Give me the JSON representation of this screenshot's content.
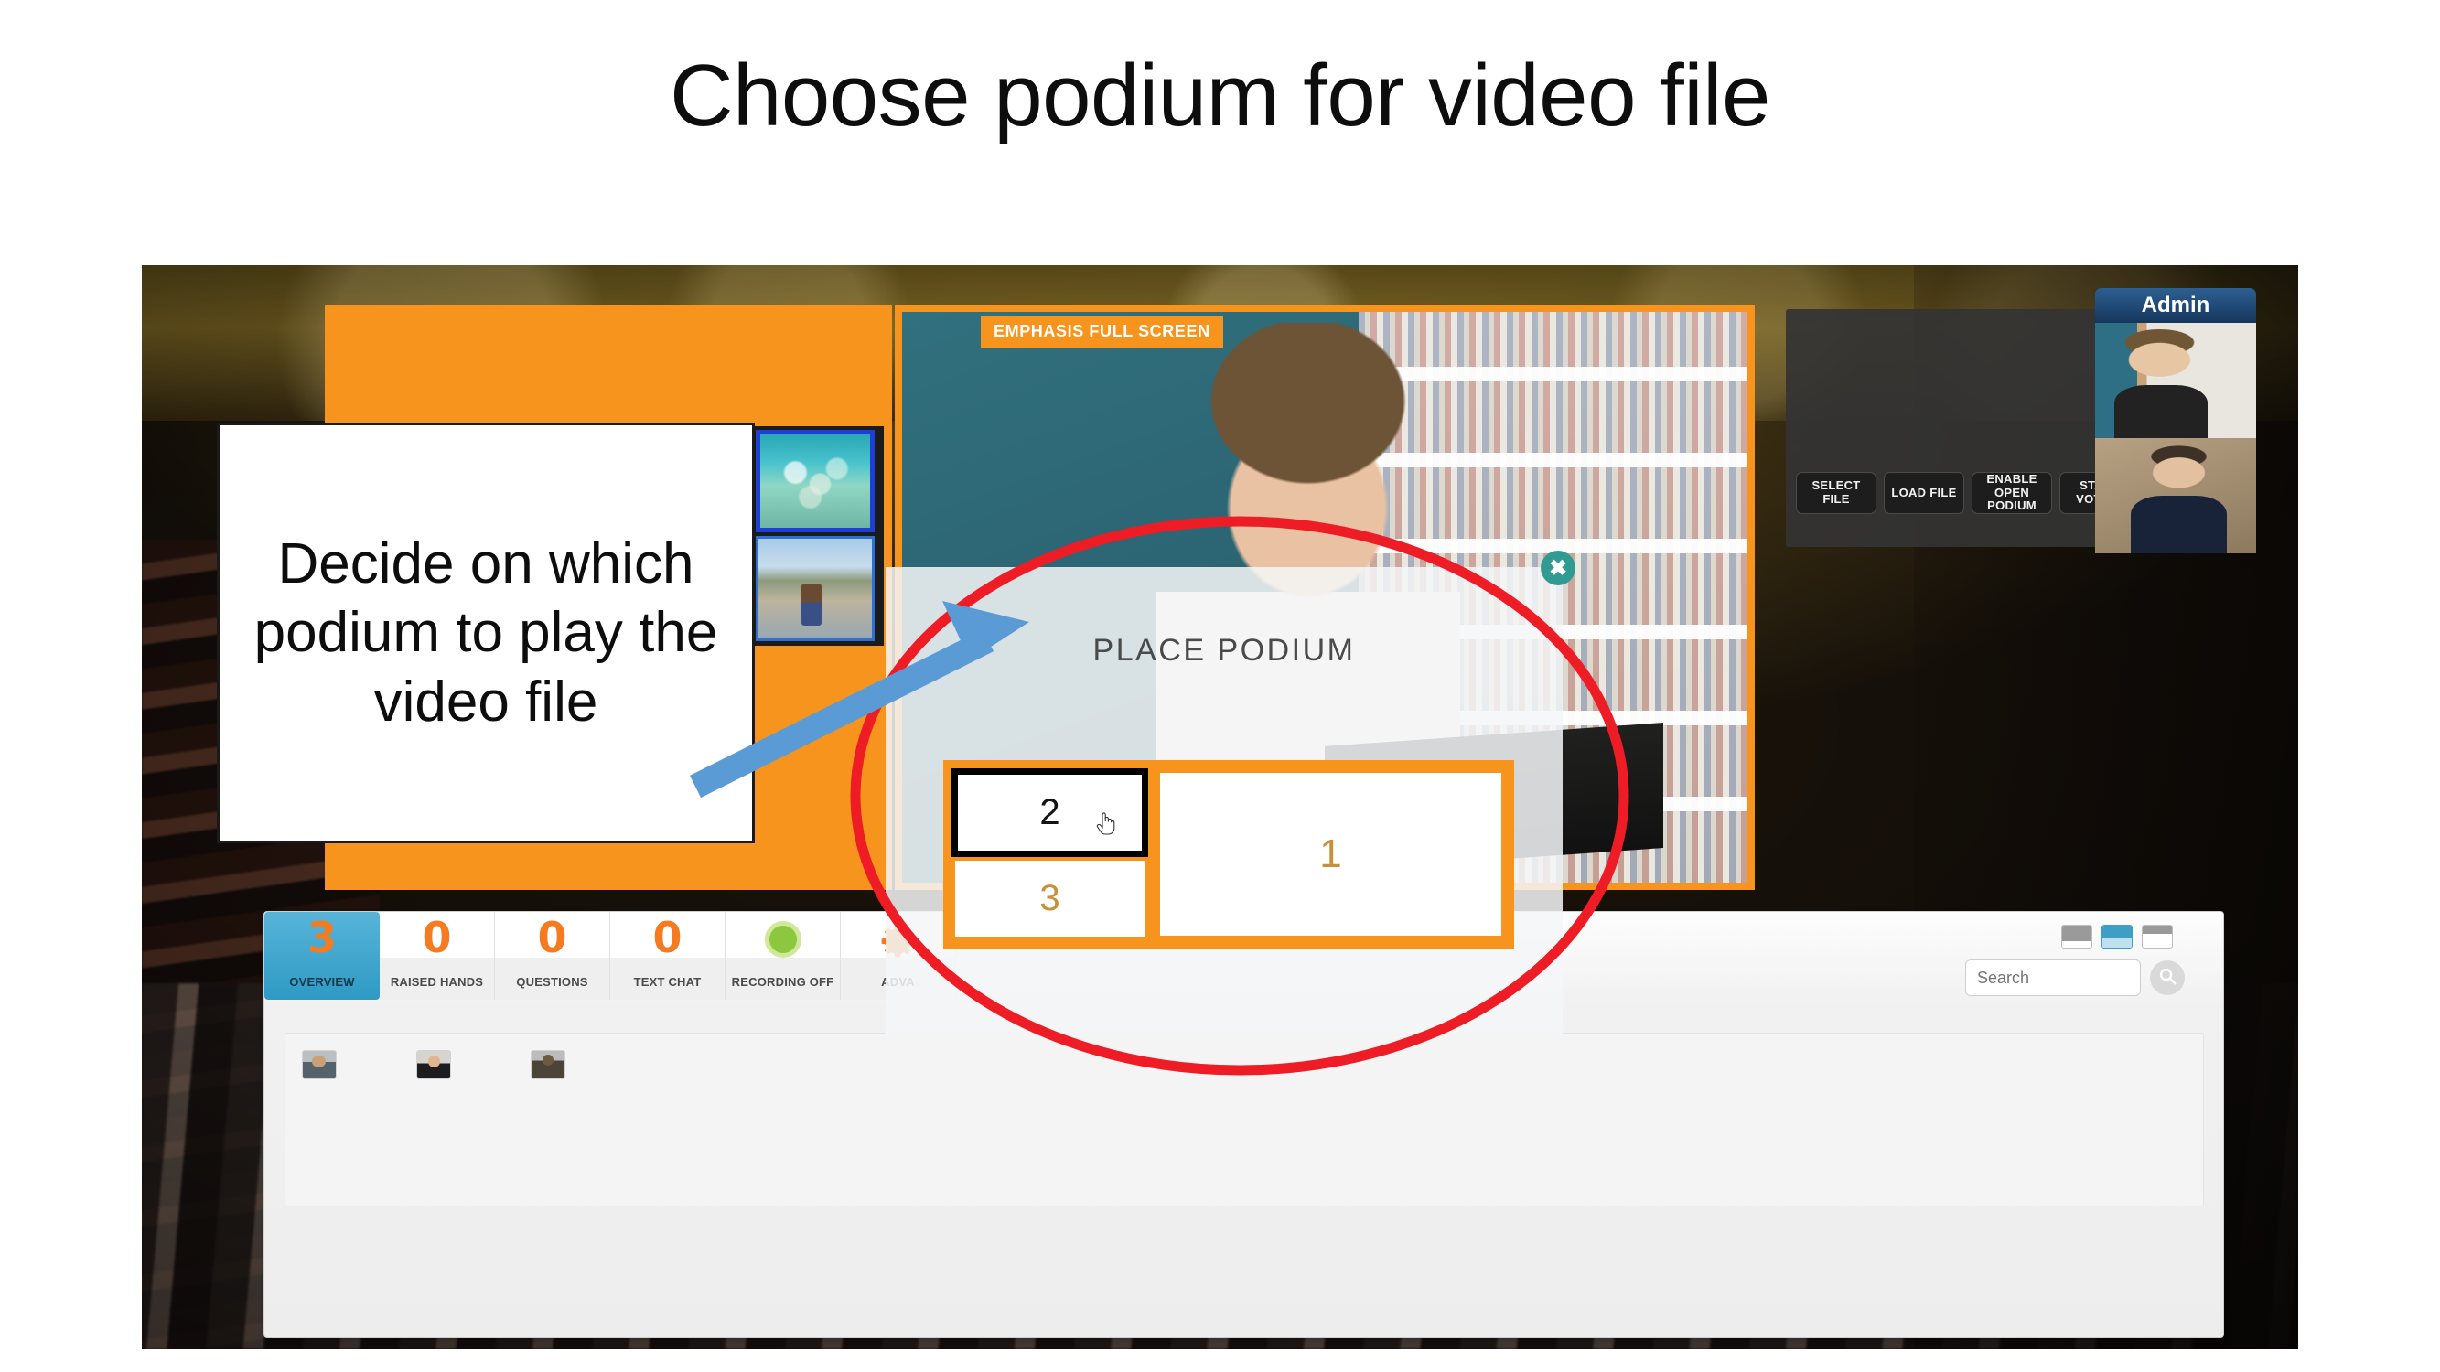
{
  "slide": {
    "title": "Choose podium for video file"
  },
  "callout": {
    "text": "Decide on which podium to play the video file",
    "arrow_icon": "arrow-up-right-icon",
    "highlight_icon": "red-ellipse-highlight-icon"
  },
  "video_panel": {
    "badge": "EMPHASIS FULL SCREEN"
  },
  "control_rack": {
    "buttons": [
      {
        "label": "SELECT FILE",
        "name": "select-file-button"
      },
      {
        "label": "LOAD FILE",
        "name": "load-file-button"
      },
      {
        "label": "ENABLE OPEN PODIUM",
        "name": "enable-open-podium-button"
      },
      {
        "label": "START VOTING",
        "name": "start-voting-button"
      }
    ]
  },
  "admin": {
    "title": "Admin",
    "cams": [
      "admin-cam-1",
      "admin-cam-2"
    ]
  },
  "podium_modal": {
    "title": "PLACE PODIUM",
    "close_icon": "close-icon",
    "cursor_icon": "pointer-hand-cursor-icon",
    "cells": [
      {
        "label": "2",
        "name": "podium-cell-2",
        "state": "hovered"
      },
      {
        "label": "3",
        "name": "podium-cell-3",
        "state": "normal"
      },
      {
        "label": "1",
        "name": "podium-cell-1",
        "state": "normal"
      }
    ]
  },
  "dashboard": {
    "stats": [
      {
        "value": "3",
        "label": "OVERVIEW",
        "active": true
      },
      {
        "value": "0",
        "label": "RAISED HANDS",
        "active": false
      },
      {
        "value": "0",
        "label": "QUESTIONS",
        "active": false
      },
      {
        "value": "0",
        "label": "TEXT CHAT",
        "active": false
      },
      {
        "value": "",
        "label": "RECORDING OFF",
        "active": false,
        "icon": "green-status-dot-icon"
      },
      {
        "value": "",
        "label": "ADVA",
        "active": false,
        "icon": "gear-icon"
      }
    ],
    "view_toggles": [
      {
        "name": "view-toggle-list",
        "active": false
      },
      {
        "name": "view-toggle-grid",
        "active": true
      },
      {
        "name": "view-toggle-compact",
        "active": false
      }
    ],
    "search": {
      "placeholder": "Search",
      "value": "",
      "icon": "search-icon"
    },
    "participants": [
      "participant-thumb-1",
      "participant-thumb-2",
      "participant-thumb-3"
    ]
  },
  "colors": {
    "orange": "#f7941e",
    "stat_orange": "#f47b20",
    "active_blue": "#2f9ac4",
    "annotation_red": "#ee1c25",
    "arrow_blue": "#5b9bd5",
    "teal_close": "#2f9b93",
    "admin_blue": "#15365c"
  }
}
